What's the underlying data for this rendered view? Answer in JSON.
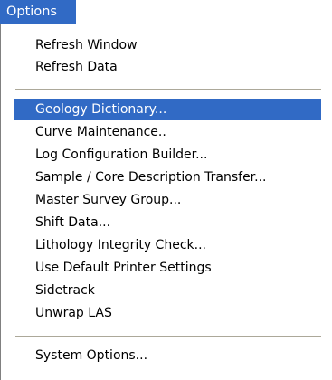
{
  "colors": {
    "highlight": "#316ac5",
    "highlight_text": "#ffffff",
    "text": "#000000",
    "separator": "#aca899"
  },
  "menubar": {
    "options_label": "Options"
  },
  "menu": {
    "groups": [
      [
        "Refresh Window",
        "Refresh Data"
      ],
      [
        "Geology Dictionary...",
        "Curve Maintenance..",
        "Log Configuration Builder...",
        "Sample / Core Description Transfer...",
        "Master Survey Group...",
        "Shift Data...",
        "Lithology Integrity Check...",
        "Use Default Printer Settings",
        "Sidetrack",
        "Unwrap LAS"
      ],
      [
        "System Options..."
      ]
    ],
    "highlighted": "Geology Dictionary..."
  }
}
